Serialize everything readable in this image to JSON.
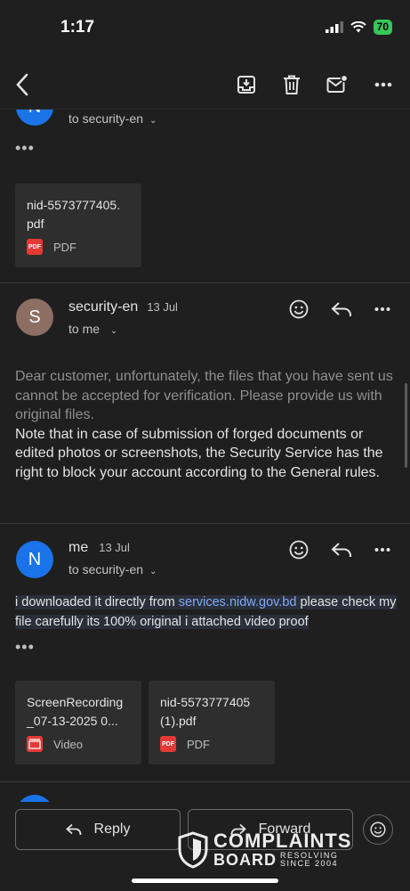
{
  "status_bar": {
    "time": "1:17",
    "battery": "70"
  },
  "thread": [
    {
      "avatar_letter": "N",
      "avatar_color": "#1a73e8",
      "recipient": "to security-en",
      "attachments": [
        {
          "name": "nid-5573777405.\npdf",
          "type": "PDF"
        }
      ]
    },
    {
      "avatar_letter": "S",
      "avatar_color": "#8d6e63",
      "sender": "security-en",
      "date": "13 Jul",
      "recipient": "to me",
      "body": [
        "Dear customer, unfortunately, the files that you have sent us cannot be accepted for verification. Please provide us with original files.",
        "Note that in case of submission of forged documents or edited photos or screenshots, the Security Service has the right to block your account according to the General rules."
      ]
    },
    {
      "avatar_letter": "N",
      "avatar_color": "#1a73e8",
      "sender": "me",
      "date": "13 Jul",
      "recipient": "to security-en",
      "body_prefix": "i downloaded it directly from ",
      "body_link": "services.nidw.gov.bd",
      "body_suffix": " please check my file carefully its 100% original i attached video proof",
      "attachments": [
        {
          "name": "ScreenRecording\n_07-13-2025 0...",
          "type": "Video"
        },
        {
          "name": "nid-5573777405\n(1).pdf",
          "type": "PDF"
        }
      ]
    }
  ],
  "actions": {
    "reply": "Reply",
    "forward": "Forward"
  },
  "watermark": {
    "line1": "COMPLAINTS",
    "line2": "BOARD",
    "sub1": "RESOLVING",
    "sub2": "SINCE 2004"
  },
  "colors": {
    "background": "#1f1f1f",
    "link": "#7cacf8",
    "pdf_red": "#e53935"
  }
}
